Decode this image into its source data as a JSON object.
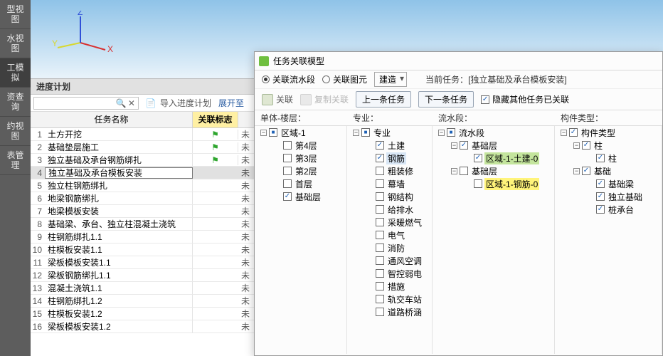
{
  "leftRail": {
    "items": [
      "型视图",
      "水视图",
      "工模拟",
      "资查询",
      "约视图",
      "表管理"
    ]
  },
  "panel": {
    "title": "进度计划",
    "import_label": "导入进度计划",
    "expand_label": "展开至"
  },
  "grid": {
    "col_name": "任务名称",
    "col_flag": "关联标志",
    "rows": [
      {
        "n": 1,
        "name": "土方开挖",
        "flag": true,
        "st": "未"
      },
      {
        "n": 2,
        "name": "基础垫层施工",
        "flag": true,
        "st": "未"
      },
      {
        "n": 3,
        "name": "独立基础及承台钢筋绑扎",
        "flag": true,
        "st": "未"
      },
      {
        "n": 4,
        "name": "独立基础及承台模板安装",
        "flag": false,
        "st": "未",
        "sel": true
      },
      {
        "n": 5,
        "name": "独立柱钢筋绑扎",
        "flag": false,
        "st": "未"
      },
      {
        "n": 6,
        "name": "地梁钢筋绑扎",
        "flag": false,
        "st": "未"
      },
      {
        "n": 7,
        "name": "地梁模板安装",
        "flag": false,
        "st": "未"
      },
      {
        "n": 8,
        "name": "基础梁、承台、独立柱混凝土浇筑",
        "flag": false,
        "st": "未"
      },
      {
        "n": 9,
        "name": "柱钢筋绑扎1.1",
        "flag": false,
        "st": "未"
      },
      {
        "n": 10,
        "name": "柱模板安装1.1",
        "flag": false,
        "st": "未"
      },
      {
        "n": 11,
        "name": "梁板模板安装1.1",
        "flag": false,
        "st": "未"
      },
      {
        "n": 12,
        "name": "梁板钢筋绑扎1.1",
        "flag": false,
        "st": "未"
      },
      {
        "n": 13,
        "name": "混凝土浇筑1.1",
        "flag": false,
        "st": "未"
      },
      {
        "n": 14,
        "name": "柱钢筋绑扎1.2",
        "flag": false,
        "st": "未"
      },
      {
        "n": 15,
        "name": "柱模板安装1.2",
        "flag": false,
        "st": "未"
      },
      {
        "n": 16,
        "name": "梁板模板安装1.2",
        "flag": false,
        "st": "未"
      }
    ]
  },
  "dialog": {
    "title": "任务关联模型",
    "opt_seg": "关联流水段",
    "opt_prim": "关联图元",
    "combo": "建造",
    "curtask_lbl": "当前任务：",
    "curtask_val": "[独立基础及承台模板安装]",
    "act_link": "关联",
    "act_copy": "复制关联",
    "btn_prev": "上一条任务",
    "btn_next": "下一条任务",
    "chk_hide": "隐藏其他任务已关联",
    "col1": "单体-楼层：",
    "col2": "专业：",
    "col3": "流水段：",
    "col4": "构件类型：",
    "tree1": {
      "root": "区域-1",
      "items": [
        "第4层",
        "第3层",
        "第2层",
        "首层",
        "基础层"
      ]
    },
    "tree2": {
      "root": "专业",
      "items": [
        "土建",
        "钢筋",
        "粗装修",
        "幕墙",
        "钢结构",
        "给排水",
        "采暖燃气",
        "电气",
        "消防",
        "通风空调",
        "智控弱电",
        "措施",
        "轨交车站",
        "道路桥涵"
      ]
    },
    "tree3": {
      "root": "流水段",
      "g1": "基础层",
      "g1i": "区域-1-土建-0",
      "g2": "基础层",
      "g2i": "区域-1-钢筋-0"
    },
    "tree4": {
      "root": "构件类型",
      "g1": "柱",
      "g1i": "柱",
      "g2": "基础",
      "g2items": [
        "基础梁",
        "独立基础",
        "桩承台"
      ]
    }
  }
}
